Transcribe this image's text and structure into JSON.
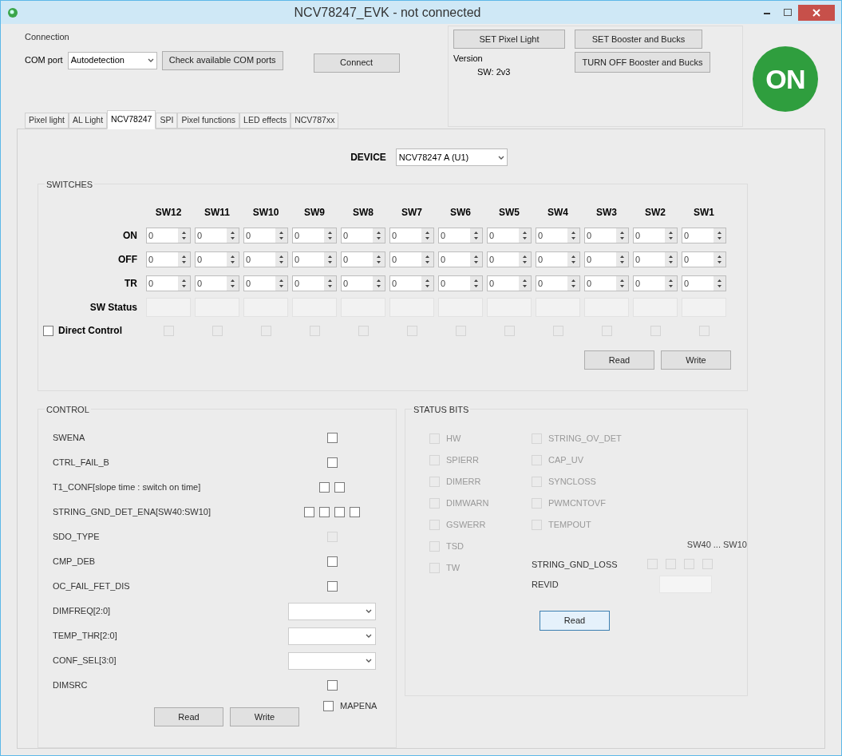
{
  "window": {
    "title": "NCV78247_EVK - not connected"
  },
  "connection": {
    "title": "Connection",
    "com_port_label": "COM port",
    "com_port_value": "Autodetection",
    "check_button": "Check available COM ports",
    "connect_button": "Connect"
  },
  "actions": {
    "set_pixel_light": "SET Pixel Light",
    "set_booster": "SET Booster and Bucks",
    "turn_off": "TURN OFF Booster and Bucks",
    "version_label": "Version",
    "version_value": "SW: 2v3"
  },
  "logo": {
    "text": "ON"
  },
  "tabs": [
    {
      "label": "Pixel light",
      "selected": false
    },
    {
      "label": "AL Light",
      "selected": false
    },
    {
      "label": "NCV78247",
      "selected": true
    },
    {
      "label": "SPI",
      "selected": false
    },
    {
      "label": "Pixel functions",
      "selected": false
    },
    {
      "label": "LED effects",
      "selected": false
    },
    {
      "label": "NCV787xx",
      "selected": false
    }
  ],
  "device": {
    "label": "DEVICE",
    "value": "NCV78247 A (U1)"
  },
  "switches": {
    "title": "SWITCHES",
    "columns": [
      "SW12",
      "SW11",
      "SW10",
      "SW9",
      "SW8",
      "SW7",
      "SW6",
      "SW5",
      "SW4",
      "SW3",
      "SW2",
      "SW1"
    ],
    "rows": [
      {
        "label": "ON",
        "values": [
          "0",
          "0",
          "0",
          "0",
          "0",
          "0",
          "0",
          "0",
          "0",
          "0",
          "0",
          "0"
        ]
      },
      {
        "label": "OFF",
        "values": [
          "0",
          "0",
          "0",
          "0",
          "0",
          "0",
          "0",
          "0",
          "0",
          "0",
          "0",
          "0"
        ]
      },
      {
        "label": "TR",
        "values": [
          "0",
          "0",
          "0",
          "0",
          "0",
          "0",
          "0",
          "0",
          "0",
          "0",
          "0",
          "0"
        ]
      }
    ],
    "status_label": "SW Status",
    "direct_control": {
      "label": "Direct Control",
      "checked": false
    },
    "direct_boxes": [
      {
        "checked": false,
        "disabled": true
      },
      {
        "checked": false,
        "disabled": true
      },
      {
        "checked": false,
        "disabled": true
      },
      {
        "checked": false,
        "disabled": true
      },
      {
        "checked": false,
        "disabled": true
      },
      {
        "checked": false,
        "disabled": true
      },
      {
        "checked": false,
        "disabled": true
      },
      {
        "checked": false,
        "disabled": true
      },
      {
        "checked": false,
        "disabled": true
      },
      {
        "checked": false,
        "disabled": true
      },
      {
        "checked": false,
        "disabled": true
      },
      {
        "checked": false,
        "disabled": true
      }
    ],
    "buttons": [
      "Read",
      "Write"
    ]
  },
  "control": {
    "title": "CONTROL",
    "items": [
      {
        "label": "SWENA",
        "kind": "checkbox",
        "boxes": [
          {
            "checked": false,
            "disabled": false
          }
        ]
      },
      {
        "label": "CTRL_FAIL_B",
        "kind": "checkbox",
        "boxes": [
          {
            "checked": false,
            "disabled": false
          }
        ]
      },
      {
        "label": "T1_CONF[slope time : switch on time]",
        "kind": "checkbox",
        "boxes": [
          {
            "checked": false,
            "disabled": false
          },
          {
            "checked": false,
            "disabled": false
          }
        ]
      },
      {
        "label": "STRING_GND_DET_ENA[SW40:SW10]",
        "kind": "checkbox",
        "boxes": [
          {
            "checked": false,
            "disabled": false
          },
          {
            "checked": false,
            "disabled": false
          },
          {
            "checked": false,
            "disabled": false
          },
          {
            "checked": false,
            "disabled": false
          }
        ]
      },
      {
        "label": "SDO_TYPE",
        "kind": "checkbox",
        "boxes": [
          {
            "checked": false,
            "disabled": true
          }
        ]
      },
      {
        "label": "CMP_DEB",
        "kind": "checkbox",
        "boxes": [
          {
            "checked": false,
            "disabled": false
          }
        ]
      },
      {
        "label": "OC_FAIL_FET_DIS",
        "kind": "checkbox",
        "boxes": [
          {
            "checked": false,
            "disabled": false
          }
        ]
      },
      {
        "label": "DIMFREQ[2:0]",
        "kind": "dropdown"
      },
      {
        "label": "TEMP_THR[2:0]",
        "kind": "dropdown"
      },
      {
        "label": "CONF_SEL[3:0]",
        "kind": "dropdown"
      },
      {
        "label": "DIMSRC",
        "kind": "checkbox",
        "boxes": [
          {
            "checked": false,
            "disabled": false
          }
        ]
      }
    ],
    "mapena": {
      "label": "MAPENA",
      "checked": false
    },
    "buttons": [
      "Read",
      "Write"
    ]
  },
  "status_bits": {
    "title": "STATUS BITS",
    "left": [
      {
        "label": "HW",
        "checked": false
      },
      {
        "label": "SPIERR",
        "checked": false
      },
      {
        "label": "DIMERR",
        "checked": false
      },
      {
        "label": "DIMWARN",
        "checked": false
      },
      {
        "label": "GSWERR",
        "checked": false
      },
      {
        "label": "TSD",
        "checked": false
      },
      {
        "label": "TW",
        "checked": false
      }
    ],
    "right": [
      {
        "label": "STRING_OV_DET",
        "checked": false
      },
      {
        "label": "CAP_UV",
        "checked": false
      },
      {
        "label": "SYNCLOSS",
        "checked": false
      },
      {
        "label": "PWMCNTOVF",
        "checked": false
      },
      {
        "label": "TEMPOUT",
        "checked": false
      }
    ],
    "range_label": "SW40 ... SW10",
    "gnd_loss_label": "STRING_GND_LOSS",
    "gnd_loss": [
      {
        "checked": false
      },
      {
        "checked": false
      },
      {
        "checked": false
      },
      {
        "checked": false
      }
    ],
    "revid_label": "REVID",
    "read_button": "Read"
  }
}
